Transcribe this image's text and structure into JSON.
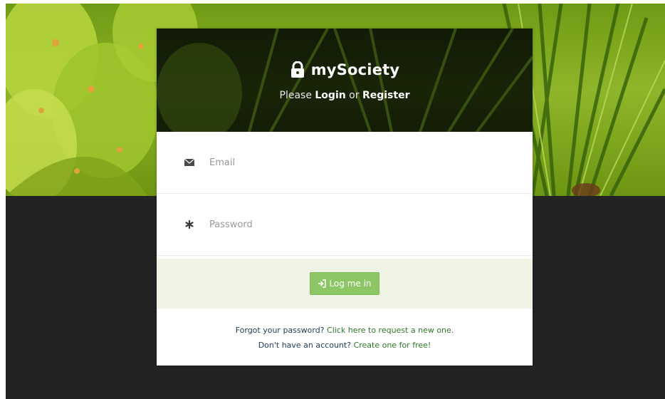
{
  "brand": {
    "title": "mySociety",
    "icon": "lock-icon"
  },
  "auth_prompt": {
    "prefix": "Please ",
    "login_label": "Login",
    "connector": " or ",
    "register_label": "Register"
  },
  "form": {
    "email": {
      "placeholder": "Email",
      "value": "",
      "icon": "envelope-icon"
    },
    "password": {
      "placeholder": "Password",
      "value": "",
      "icon": "asterisk-icon"
    },
    "submit_label": "Log me in",
    "submit_icon": "sign-in-icon"
  },
  "footer": {
    "forgot_text": "Forgot your password?",
    "forgot_link": "Click here to request a new one.",
    "signup_text": "Don't have an account?",
    "signup_link": "Create one for free!"
  },
  "colors": {
    "page_dark": "#232323",
    "accent_green": "#8cc665",
    "action_bar": "#eef3e4",
    "link_green": "#2f7a2a",
    "text_navy": "#1f3a5a"
  }
}
